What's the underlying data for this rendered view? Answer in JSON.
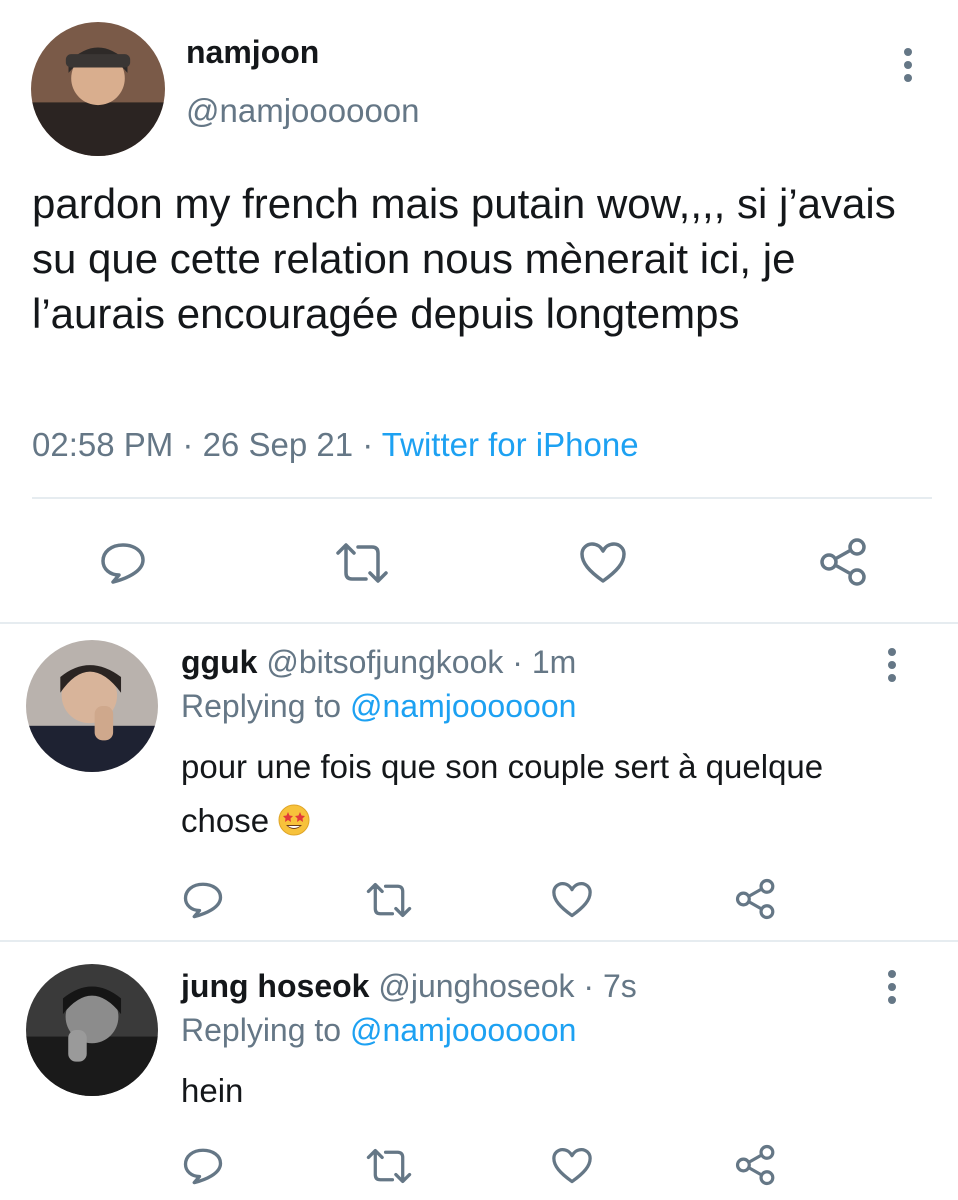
{
  "main_tweet": {
    "name": "namjoon",
    "handle": "@namjoooooon",
    "text": "pardon my french mais putain wow,,,, si j’avais su que cette relation nous mènerait ici, je l’aurais encouragée depuis longtemps",
    "time": "02:58 PM",
    "date": "26 Sep 21",
    "source": "Twitter for iPhone",
    "separator": " · "
  },
  "replies": [
    {
      "name": "gguk",
      "handle": "@bitsofjungkook",
      "age": "1m",
      "replying_label": "Replying to",
      "replying_to": "@namjoooooon",
      "text": "pour une fois que son couple sert à quelque chose",
      "emoji": "star-struck-emoji"
    },
    {
      "name": "jung hoseok",
      "handle": "@junghoseok",
      "age": "7s",
      "replying_label": "Replying to",
      "replying_to": "@namjoooooon",
      "text": "hein"
    }
  ],
  "icons": {
    "reply": "reply-icon",
    "retweet": "retweet-icon",
    "like": "like-icon",
    "share": "share-icon",
    "more": "more-options-icon"
  },
  "colors": {
    "text": "#14171a",
    "secondary": "#657786",
    "link": "#1da1f2",
    "divider": "#e6ecf0"
  }
}
